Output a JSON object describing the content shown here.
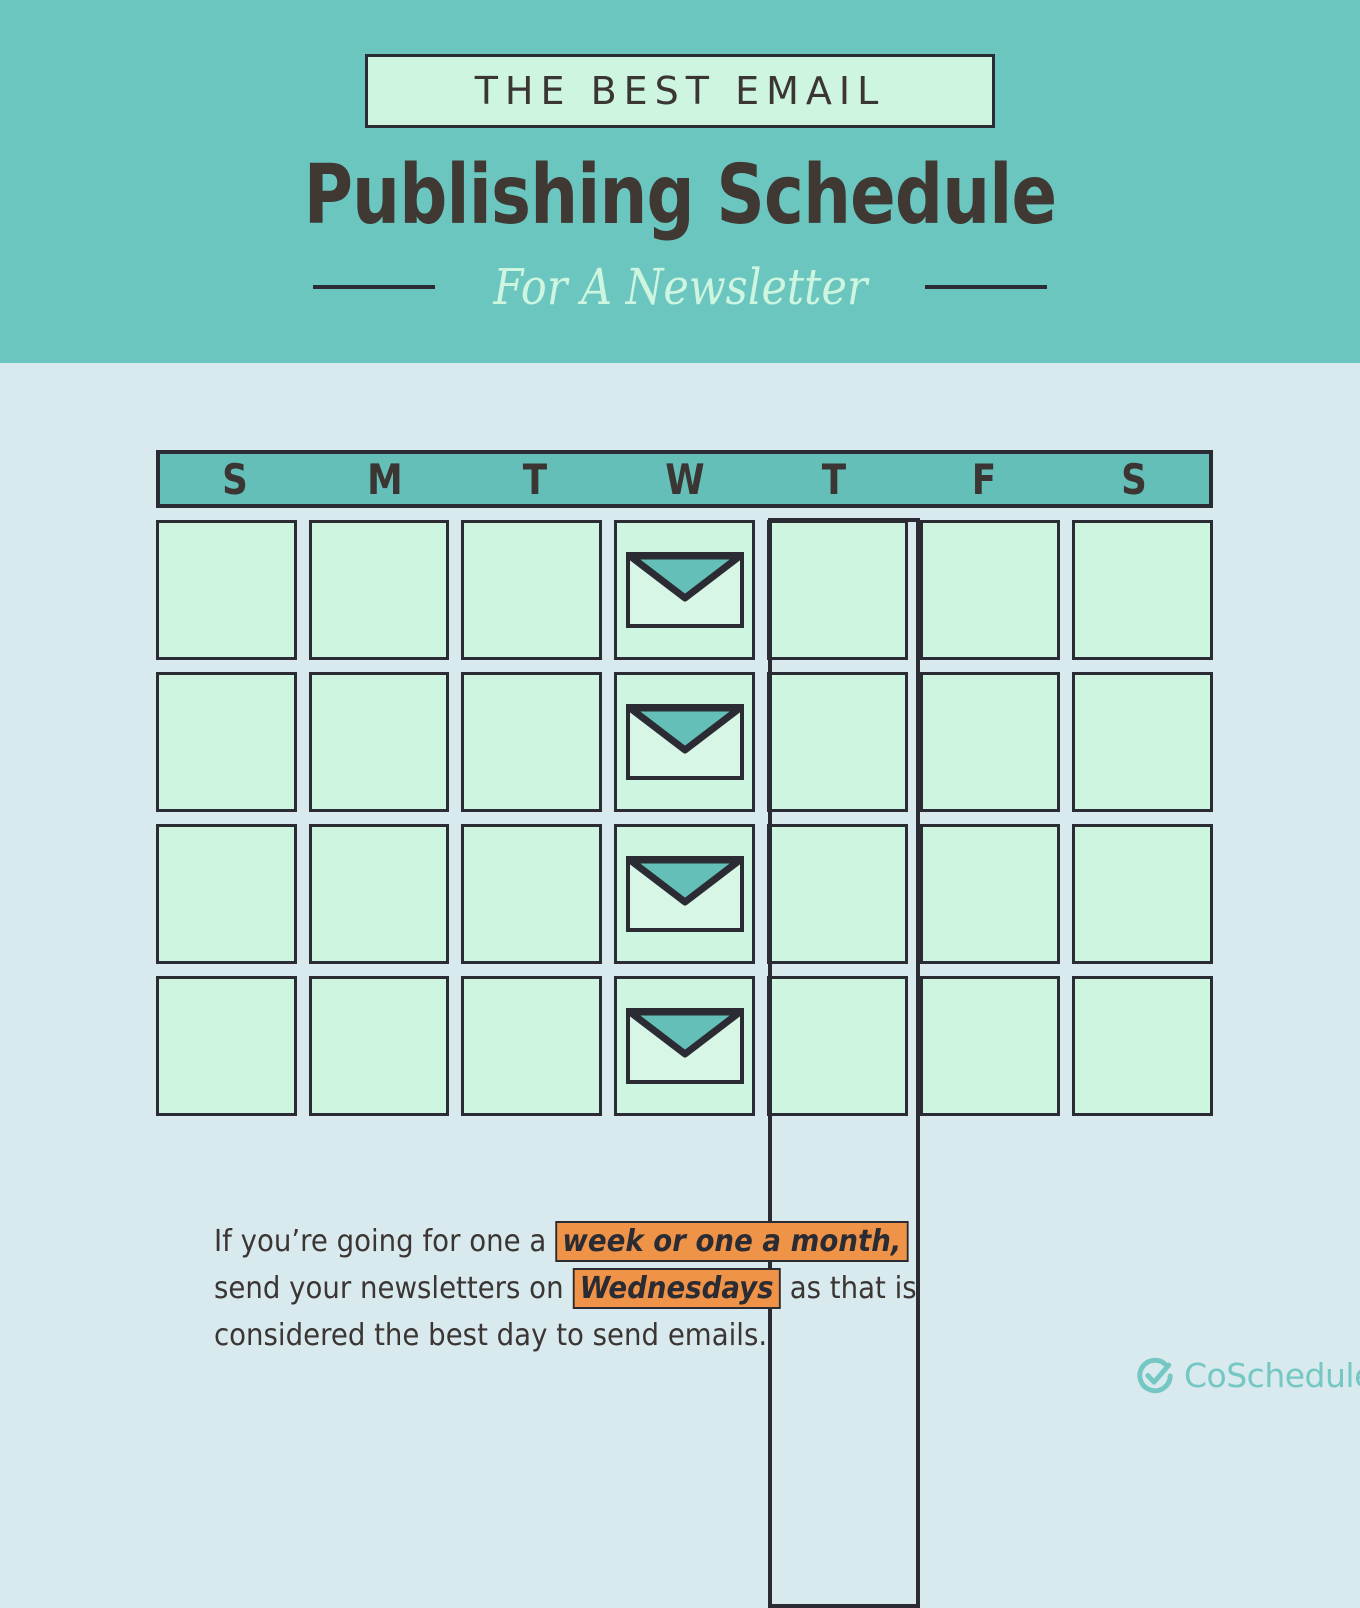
{
  "header": {
    "eyebrow": "THE BEST EMAIL",
    "title": "Publishing Schedule",
    "subtitle": "For A Newsletter",
    "band_color": "#6cc6c0",
    "eyebrow_box_color": "#cdf5e0",
    "title_color": "#403833",
    "subtitle_color": "#cdf5e0"
  },
  "page": {
    "background_color": "#d9eaee",
    "ink_color": "#2b2b33"
  },
  "calendar": {
    "day_headers": [
      "S",
      "M",
      "T",
      "W",
      "T",
      "F",
      "S"
    ],
    "header_band_color": "#63bfb8",
    "cell_color": "#cdf5e0",
    "highlighted_column_index": 3,
    "highlighted_column_label": "W",
    "rows": [
      {
        "cells": [
          {
            "icon": null
          },
          {
            "icon": null
          },
          {
            "icon": null
          },
          {
            "icon": "envelope-icon"
          },
          {
            "icon": null
          },
          {
            "icon": null
          },
          {
            "icon": null
          }
        ]
      },
      {
        "cells": [
          {
            "icon": null
          },
          {
            "icon": null
          },
          {
            "icon": null
          },
          {
            "icon": "envelope-icon"
          },
          {
            "icon": null
          },
          {
            "icon": null
          },
          {
            "icon": null
          }
        ]
      },
      {
        "cells": [
          {
            "icon": null
          },
          {
            "icon": null
          },
          {
            "icon": null
          },
          {
            "icon": "envelope-icon"
          },
          {
            "icon": null
          },
          {
            "icon": null
          },
          {
            "icon": null
          }
        ]
      },
      {
        "cells": [
          {
            "icon": null
          },
          {
            "icon": null
          },
          {
            "icon": null
          },
          {
            "icon": "envelope-icon"
          },
          {
            "icon": null
          },
          {
            "icon": null
          },
          {
            "icon": null
          }
        ]
      }
    ],
    "envelope": {
      "body_color": "#d7f6e6",
      "flap_color": "#63bfb8"
    }
  },
  "caption": {
    "part1": "If you’re going for one a ",
    "highlight1": "week or one a month,",
    "part2": " send your newsletters on ",
    "highlight2": "Wednesdays",
    "part3": " as that is considered the best day to send emails.",
    "highlight_color": "#ef9348"
  },
  "logo": {
    "text": "CoSchedule",
    "icon": "check-circle-icon",
    "color": "#74c7c2"
  }
}
